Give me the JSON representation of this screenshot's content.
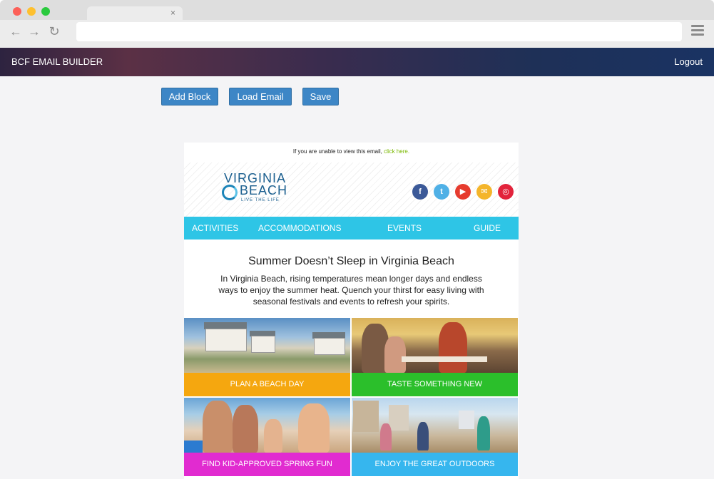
{
  "browser": {
    "tab_close": "×"
  },
  "app": {
    "title": "BCF EMAIL BUILDER",
    "logout": "Logout",
    "buttons": {
      "add_block": "Add Block",
      "load_email": "Load Email",
      "save": "Save"
    }
  },
  "email": {
    "preheader_text": "If you are unable to view this email,",
    "preheader_link": "click here.",
    "logo": {
      "line1": "VIRGINIA",
      "line2": "BEACH",
      "tagline": "LIVE THE LIFE"
    },
    "social_icons": [
      {
        "name": "facebook-icon",
        "glyph": "f",
        "color": "#3b5998"
      },
      {
        "name": "twitter-icon",
        "glyph": "t",
        "color": "#4fb0e6"
      },
      {
        "name": "youtube-icon",
        "glyph": "▶",
        "color": "#e63b2e"
      },
      {
        "name": "email-icon",
        "glyph": "✉",
        "color": "#f4b52a"
      },
      {
        "name": "instagram-icon",
        "glyph": "◎",
        "color": "#e2233b"
      }
    ],
    "nav": [
      "ACTIVITIES",
      "ACCOMMODATIONS",
      "EVENTS",
      "GUIDE"
    ],
    "headline": "Summer Doesn’t Sleep in Virginia Beach",
    "intro": "In Virginia Beach, rising temperatures mean longer days and endless ways to enjoy the summer heat. Quench your thirst for easy living with seasonal festivals and events to refresh your spirits.",
    "tiles": [
      {
        "label": "PLAN A BEACH DAY",
        "color": "#f5a70f"
      },
      {
        "label": "TASTE SOMETHING NEW",
        "color": "#2bbf2b"
      },
      {
        "label": "FIND KID-APPROVED SPRING FUN",
        "color": "#e12bd0"
      },
      {
        "label": "ENJOY THE GREAT OUTDOORS",
        "color": "#36b6ee"
      }
    ]
  },
  "colors": {
    "button": "#3d86c6",
    "nav_bar": "#2ec5e6",
    "link": "#7ab800"
  }
}
